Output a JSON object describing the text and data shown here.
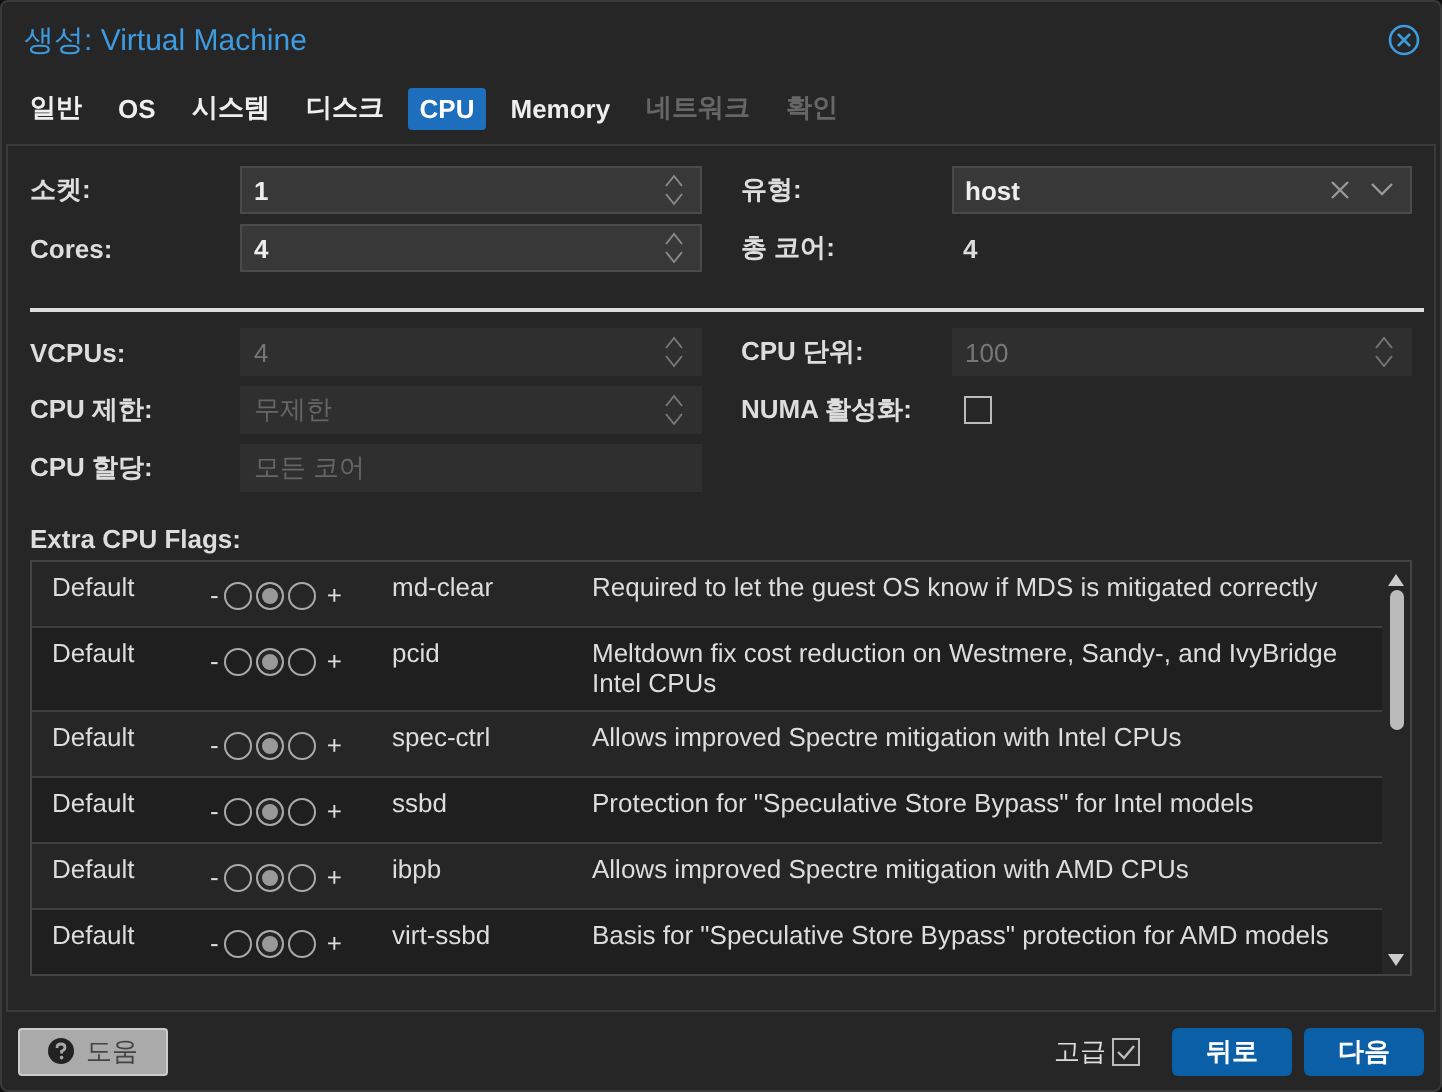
{
  "window": {
    "title_prefix": "생성:",
    "title": "Virtual Machine"
  },
  "tabs": [
    {
      "label": "일반",
      "selected": false,
      "disabled": false
    },
    {
      "label": "OS",
      "selected": false,
      "disabled": false
    },
    {
      "label": "시스템",
      "selected": false,
      "disabled": false
    },
    {
      "label": "디스크",
      "selected": false,
      "disabled": false
    },
    {
      "label": "CPU",
      "selected": true,
      "disabled": false
    },
    {
      "label": "Memory",
      "selected": false,
      "disabled": false
    },
    {
      "label": "네트워크",
      "selected": false,
      "disabled": true
    },
    {
      "label": "확인",
      "selected": false,
      "disabled": true
    }
  ],
  "basic": {
    "left": [
      {
        "label": "소켓:",
        "kind": "spin",
        "value": "1",
        "disabled": false
      },
      {
        "label": "Cores:",
        "kind": "spin",
        "value": "4",
        "disabled": false
      }
    ],
    "right": [
      {
        "label": "유형:",
        "kind": "combo",
        "value": "host"
      },
      {
        "label": "총 코어:",
        "kind": "display",
        "value": "4"
      }
    ]
  },
  "advanced": {
    "left": [
      {
        "label": "VCPUs:",
        "kind": "spin",
        "value": "4",
        "disabled": true
      },
      {
        "label": "CPU 제한:",
        "kind": "spin",
        "placeholder": "무제한",
        "disabled": true
      },
      {
        "label": "CPU 할당:",
        "kind": "text",
        "placeholder": "모든 코어",
        "disabled": true
      }
    ],
    "right": [
      {
        "label": "CPU 단위:",
        "kind": "spin",
        "value": "100",
        "disabled": true
      },
      {
        "label": "NUMA 활성화:",
        "kind": "checkbox",
        "checked": false
      }
    ]
  },
  "flags": {
    "label": "Extra CPU Flags:",
    "rows": [
      {
        "setting": "Default",
        "options": [
          {
            "selected": false
          },
          {
            "selected": true
          },
          {
            "selected": false
          }
        ],
        "name": "md-clear",
        "description": "Required to let the guest OS know if MDS is mitigated correctly"
      },
      {
        "setting": "Default",
        "options": [
          {
            "selected": false
          },
          {
            "selected": true
          },
          {
            "selected": false
          }
        ],
        "name": "pcid",
        "description": "Meltdown fix cost reduction on Westmere, Sandy-, and IvyBridge Intel CPUs"
      },
      {
        "setting": "Default",
        "options": [
          {
            "selected": false
          },
          {
            "selected": true
          },
          {
            "selected": false
          }
        ],
        "name": "spec-ctrl",
        "description": "Allows improved Spectre mitigation with Intel CPUs"
      },
      {
        "setting": "Default",
        "options": [
          {
            "selected": false
          },
          {
            "selected": true
          },
          {
            "selected": false
          }
        ],
        "name": "ssbd",
        "description": "Protection for \"Speculative Store Bypass\" for Intel models"
      },
      {
        "setting": "Default",
        "options": [
          {
            "selected": false
          },
          {
            "selected": true
          },
          {
            "selected": false
          }
        ],
        "name": "ibpb",
        "description": "Allows improved Spectre mitigation with AMD CPUs"
      },
      {
        "setting": "Default",
        "options": [
          {
            "selected": false
          },
          {
            "selected": true
          },
          {
            "selected": false
          }
        ],
        "name": "virt-ssbd",
        "description": "Basis for \"Speculative Store Bypass\" protection for AMD models"
      }
    ],
    "minus": "-",
    "plus": "+"
  },
  "footer": {
    "help": "도움",
    "advanced_label": "고급",
    "advanced_checked": true,
    "buttons": [
      "뒤로",
      "다음"
    ]
  }
}
